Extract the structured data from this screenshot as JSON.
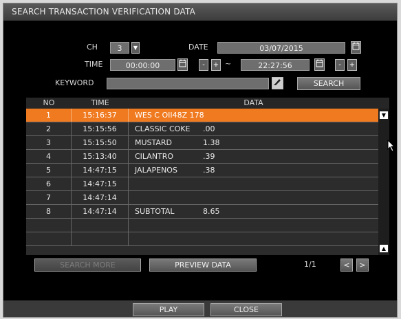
{
  "window": {
    "title": "SEARCH TRANSACTION VERIFICATION DATA"
  },
  "form": {
    "ch_label": "CH",
    "ch_value": "3",
    "date_label": "DATE",
    "date_value": "03/07/2015",
    "time_label": "TIME",
    "time_from": "00:00:00",
    "time_to": "22:27:56",
    "tilde": "~",
    "minus": "-",
    "plus": "+",
    "keyword_label": "KEYWORD",
    "keyword_value": "",
    "search_label": "SEARCH"
  },
  "table": {
    "headers": {
      "no": "NO",
      "time": "TIME",
      "data": "DATA"
    },
    "rows": [
      {
        "no": "1",
        "time": "15:16:37",
        "item": "WES C OII48Z 178",
        "value": ""
      },
      {
        "no": "2",
        "time": "15:15:56",
        "item": "CLASSIC COKE",
        "value": ".00"
      },
      {
        "no": "3",
        "time": "15:15:50",
        "item": "MUSTARD",
        "value": "1.38"
      },
      {
        "no": "4",
        "time": "15:13:40",
        "item": "CILANTRO",
        "value": ".39"
      },
      {
        "no": "5",
        "time": "14:47:15",
        "item": "JALAPENOS",
        "value": ".38"
      },
      {
        "no": "6",
        "time": "14:47:15",
        "item": "",
        "value": ""
      },
      {
        "no": "7",
        "time": "14:47:14",
        "item": "",
        "value": ""
      },
      {
        "no": "8",
        "time": "14:47:14",
        "item": " SUBTOTAL",
        "value": "8.65"
      },
      {
        "no": "",
        "time": "",
        "item": "",
        "value": ""
      },
      {
        "no": "",
        "time": "",
        "item": "",
        "value": ""
      }
    ],
    "selected_row": 0
  },
  "actions": {
    "search_more": "SEARCH MORE",
    "preview_data": "PREVIEW DATA",
    "page": "1/1",
    "prev": "<",
    "next": ">"
  },
  "footer": {
    "play": "PLAY",
    "close": "CLOSE"
  },
  "colors": {
    "selection": "#f07a20",
    "background": "#000000"
  },
  "icons": [
    "chevron-down-icon",
    "calendar-icon",
    "keyboard-icon",
    "scroll-up-icon",
    "scroll-down-icon",
    "mouse-pointer-icon"
  ]
}
